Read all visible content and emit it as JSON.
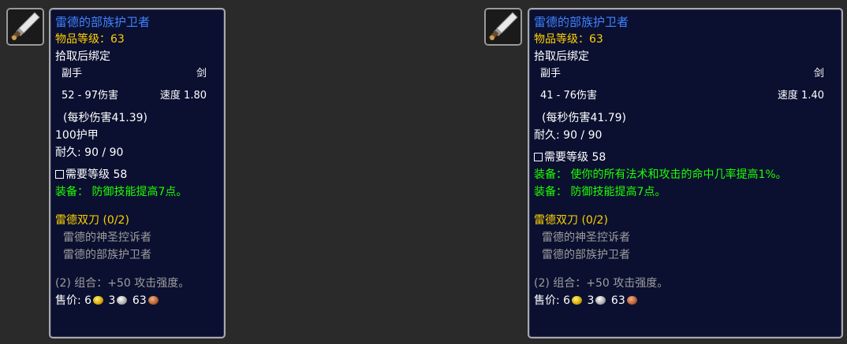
{
  "tooltips": [
    {
      "name": "雷德的部族护卫者",
      "item_level_label": "物品等级：",
      "item_level": "63",
      "binding": "拾取后绑定",
      "slot": "副手",
      "type": "剑",
      "damage": "52 - 97伤害",
      "speed": "速度 1.80",
      "dps": "(每秒伤害41.39)",
      "armor": "100护甲",
      "durability": "耐久: 90 / 90",
      "requires": "需要等级 58",
      "equips": [
        "装备： 防御技能提高7点。"
      ],
      "set_name": "雷德双刀 (0/2)",
      "set_items": [
        "雷德的神圣控诉者",
        "雷德的部族护卫者"
      ],
      "set_bonus": "(2) 组合：+50 攻击强度。",
      "sell_label": "售价:",
      "sell_gold": "6",
      "sell_silver": "3",
      "sell_copper": "63"
    },
    {
      "name": "雷德的部族护卫者",
      "item_level_label": "物品等级：",
      "item_level": "63",
      "binding": "拾取后绑定",
      "slot": "副手",
      "type": "剑",
      "damage": "41 - 76伤害",
      "speed": "速度 1.40",
      "dps": "(每秒伤害41.79)",
      "armor": "",
      "durability": "耐久: 90 / 90",
      "requires": "需要等级 58",
      "equips": [
        "装备： 使你的所有法术和攻击的命中几率提高1%。",
        "装备： 防御技能提高7点。"
      ],
      "set_name": "雷德双刀 (0/2)",
      "set_items": [
        "雷德的神圣控诉者",
        "雷德的部族护卫者"
      ],
      "set_bonus": "(2) 组合：+50 攻击强度。",
      "sell_label": "售价:",
      "sell_gold": "6",
      "sell_silver": "3",
      "sell_copper": "63"
    }
  ],
  "icon": "sword-item-icon",
  "colors": {
    "item_name": "#3f82ff",
    "item_level": "#ffd100",
    "equip_effect": "#1eff00",
    "set_bonus_inactive": "#9d9d9d",
    "tooltip_bg": "#0b1030",
    "page_bg": "#2a2a2a"
  }
}
